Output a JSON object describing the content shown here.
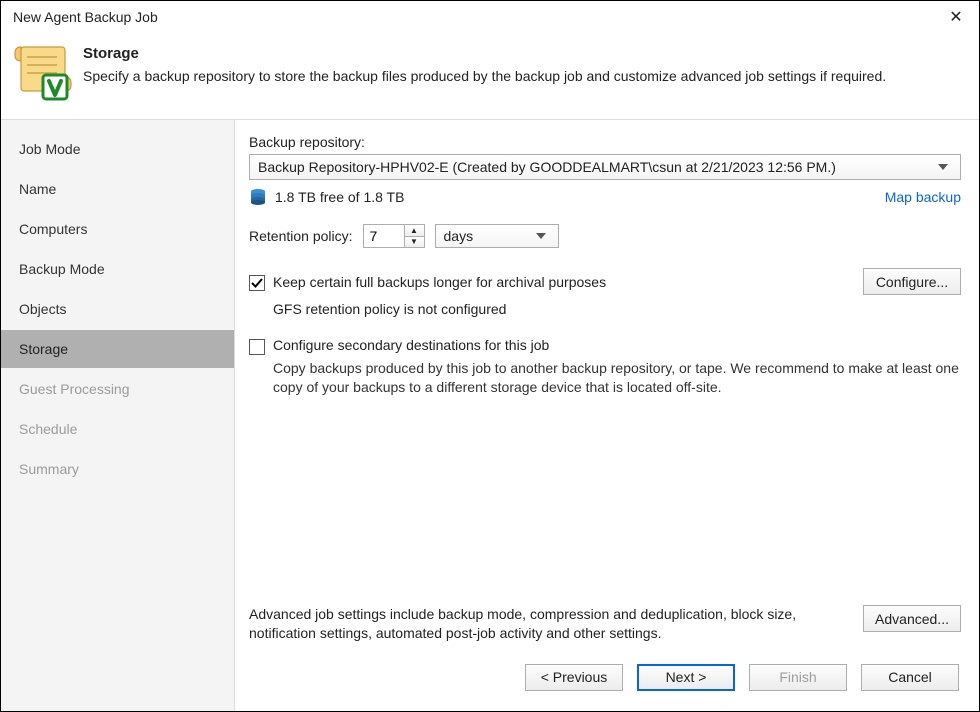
{
  "window": {
    "title": "New Agent Backup Job"
  },
  "header": {
    "title": "Storage",
    "desc": "Specify a backup repository to store the backup files produced by the backup job and customize advanced job settings if required."
  },
  "sidebar": {
    "steps": [
      {
        "label": "Job Mode",
        "state": "past"
      },
      {
        "label": "Name",
        "state": "past"
      },
      {
        "label": "Computers",
        "state": "past"
      },
      {
        "label": "Backup Mode",
        "state": "past"
      },
      {
        "label": "Objects",
        "state": "past"
      },
      {
        "label": "Storage",
        "state": "active"
      },
      {
        "label": "Guest Processing",
        "state": "disabled"
      },
      {
        "label": "Schedule",
        "state": "disabled"
      },
      {
        "label": "Summary",
        "state": "disabled"
      }
    ]
  },
  "storage": {
    "repo_label": "Backup repository:",
    "repo_value": "Backup Repository-HPHV02-E (Created by GOODDEALMART\\csun at 2/21/2023 12:56 PM.)",
    "free_text": "1.8 TB free of 1.8 TB",
    "map_backup": "Map backup",
    "retention_label": "Retention policy:",
    "retention_value": "7",
    "retention_unit": "days",
    "gfs_checkbox": "Keep certain full backups longer for archival purposes",
    "gfs_checked": true,
    "gfs_status": "GFS retention policy is not configured",
    "configure_btn": "Configure...",
    "secondary_checkbox": "Configure secondary destinations for this job",
    "secondary_checked": false,
    "secondary_desc": "Copy backups produced by this job to another backup repository, or tape. We recommend to make at least one copy of your backups to a different storage device that is located off-site.",
    "advanced_desc": "Advanced job settings include backup mode, compression and deduplication, block size, notification settings, automated post-job activity and other settings.",
    "advanced_btn": "Advanced..."
  },
  "footer": {
    "previous": "< Previous",
    "next": "Next >",
    "finish": "Finish",
    "cancel": "Cancel"
  }
}
